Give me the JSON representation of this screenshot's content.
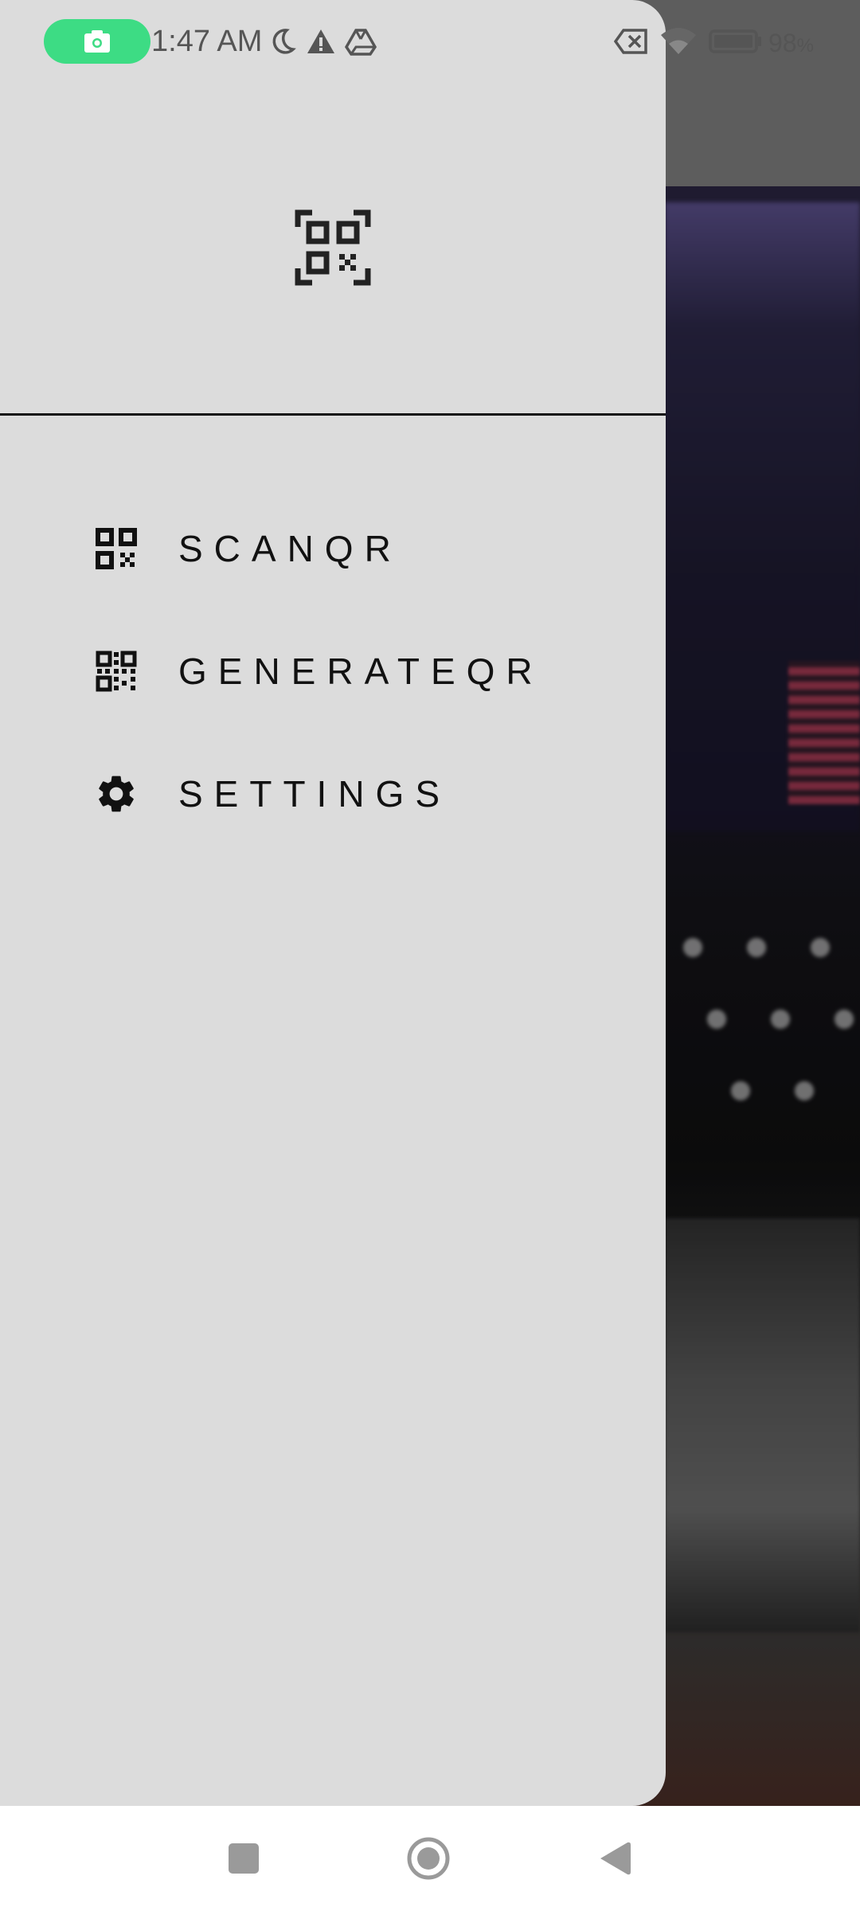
{
  "status_bar": {
    "time": "1:47 AM",
    "battery_percent": "98",
    "battery_unit": "%",
    "icons": [
      "camera-icon",
      "moon-icon",
      "warning-icon",
      "drive-icon",
      "no-sim-icon",
      "wifi-icon",
      "battery-icon"
    ]
  },
  "drawer": {
    "logo_icon": "qr-scan-icon",
    "menu_items": [
      {
        "label": "SCANQR",
        "icon": "qr-code-icon"
      },
      {
        "label": "GENERATEQR",
        "icon": "qr-code-generate-icon"
      },
      {
        "label": "SETTINGS",
        "icon": "gear-icon"
      }
    ]
  },
  "nav_bar": {
    "buttons": [
      "recents-button",
      "home-button",
      "back-button"
    ]
  },
  "colors": {
    "drawer_bg": "#dcdcdc",
    "camera_pill": "#3ddc84",
    "text_primary": "#111111"
  }
}
